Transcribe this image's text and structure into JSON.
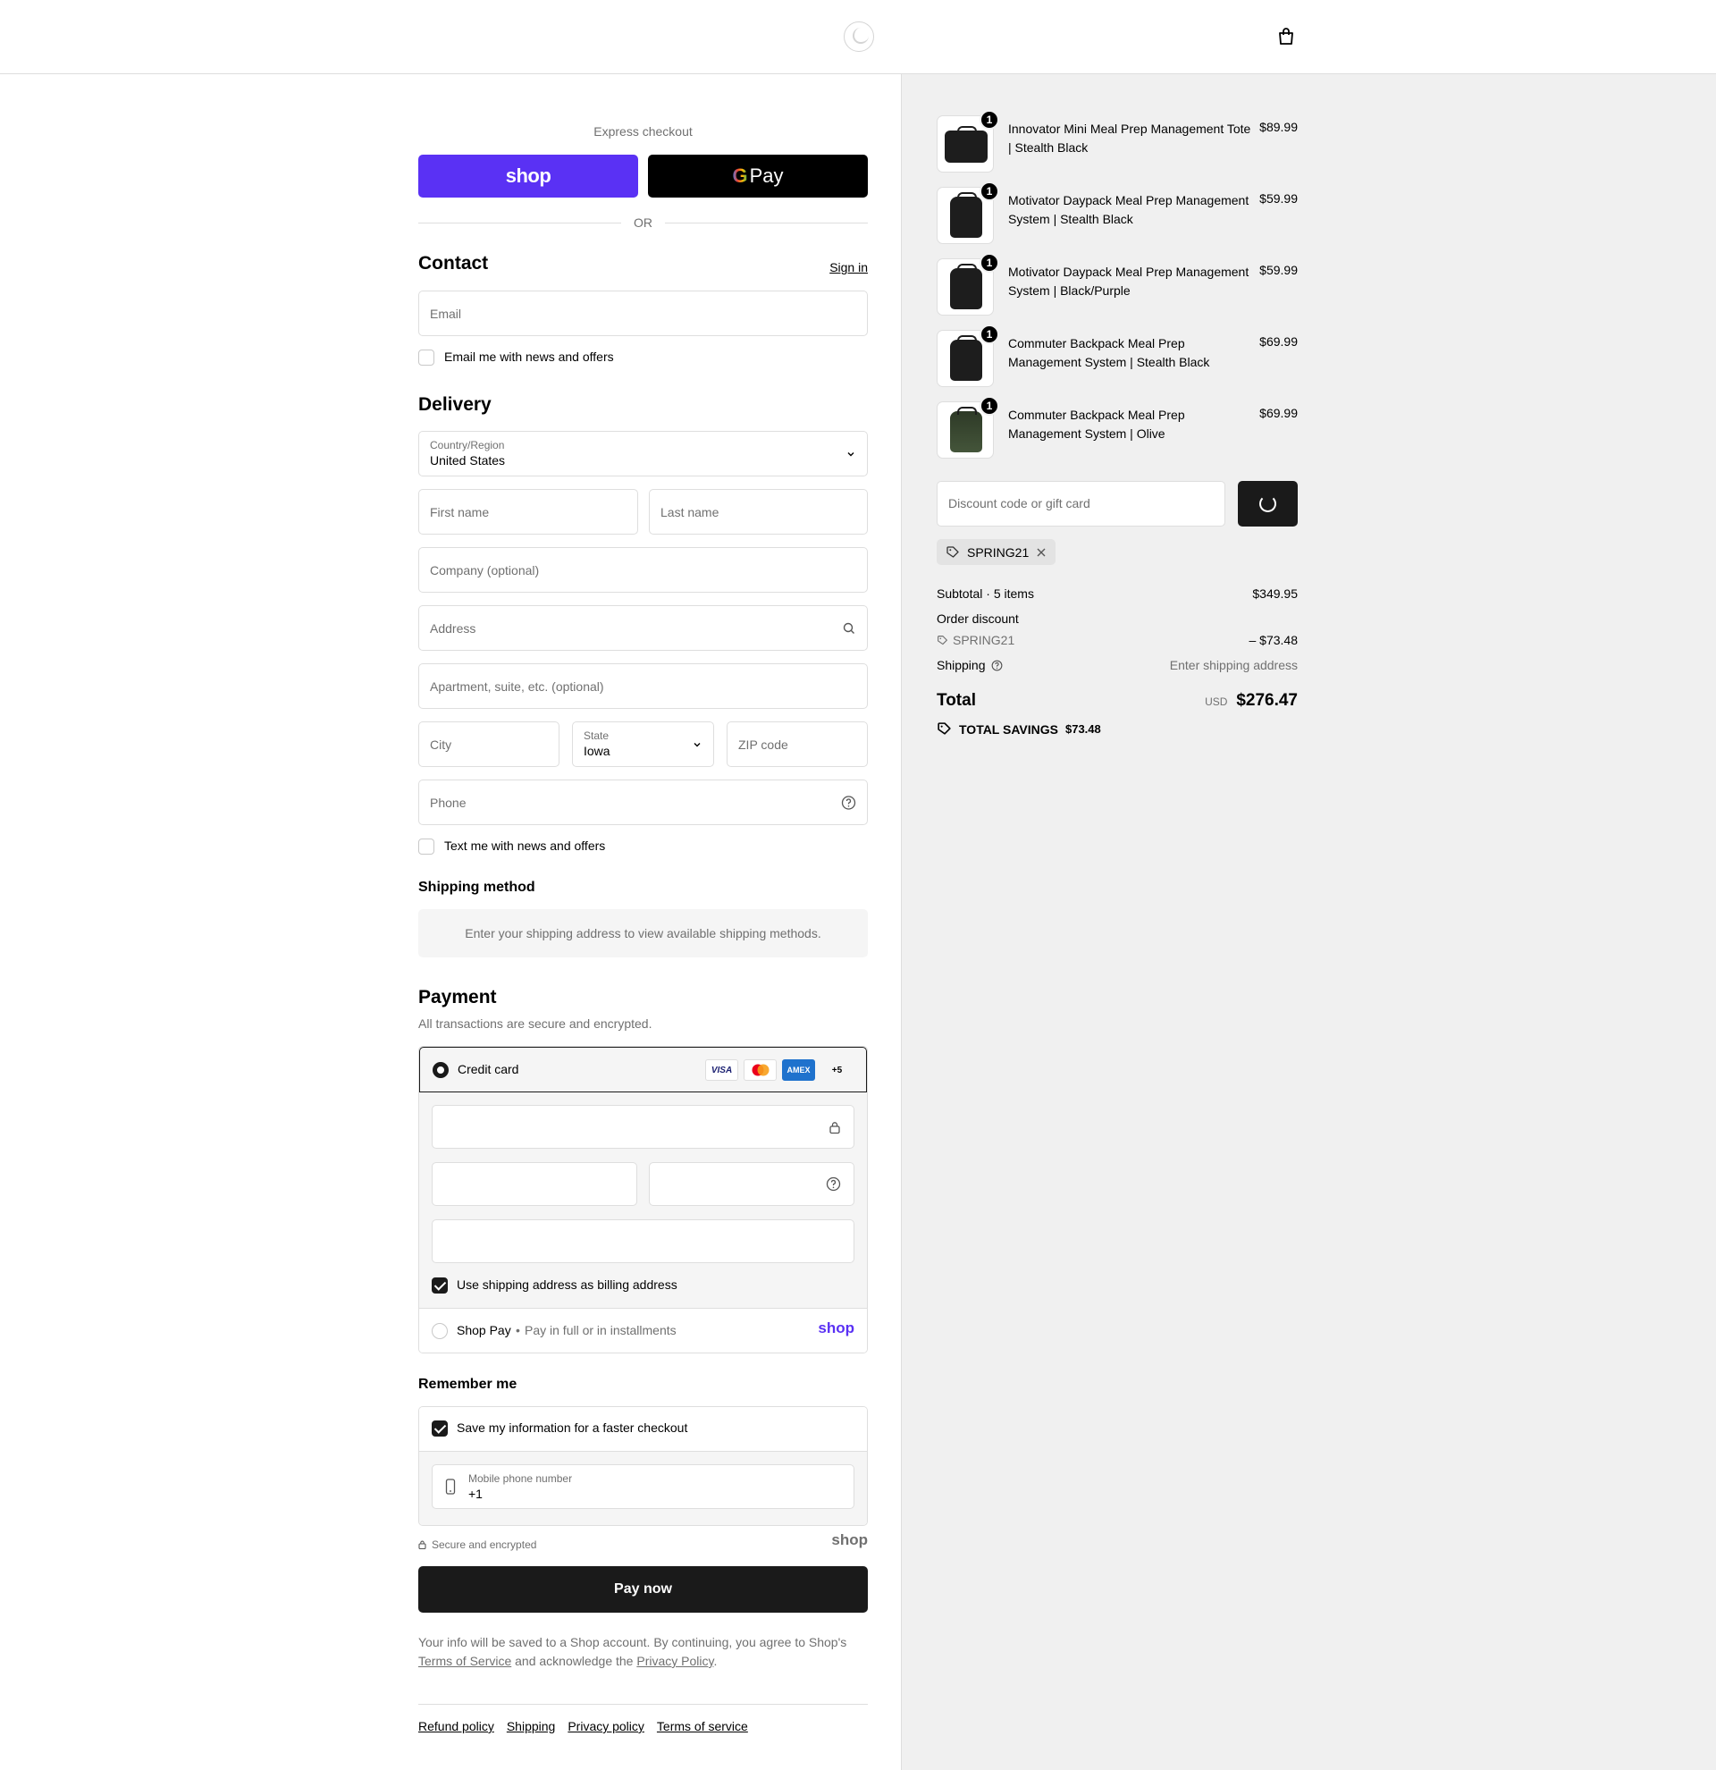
{
  "header": {
    "logo_icon": "store-logo-icon",
    "cart_icon": "shopping-bag-icon"
  },
  "express": {
    "label": "Express checkout",
    "shop_pay_label": "shop",
    "gpay_g": "G",
    "gpay_label": "Pay",
    "or_label": "OR"
  },
  "contact": {
    "title": "Contact",
    "sign_in": "Sign in",
    "email_placeholder": "Email",
    "newsletter_label": "Email me with news and offers"
  },
  "delivery": {
    "title": "Delivery",
    "country_label": "Country/Region",
    "country_value": "United States",
    "first_name_placeholder": "First name",
    "last_name_placeholder": "Last name",
    "company_placeholder": "Company (optional)",
    "address_placeholder": "Address",
    "apartment_placeholder": "Apartment, suite, etc. (optional)",
    "city_placeholder": "City",
    "state_label": "State",
    "state_value": "Iowa",
    "zip_placeholder": "ZIP code",
    "phone_placeholder": "Phone",
    "sms_label": "Text me with news and offers"
  },
  "shipping_method": {
    "title": "Shipping method",
    "notice": "Enter your shipping address to view available shipping methods."
  },
  "payment": {
    "title": "Payment",
    "subtitle": "All transactions are secure and encrypted.",
    "credit_card_label": "Credit card",
    "cards": [
      "VISA",
      "MC",
      "AMEX",
      "+5"
    ],
    "billing_label": "Use shipping address as billing address",
    "shop_pay_label": "Shop Pay",
    "shop_pay_sub": "Pay in full or in installments",
    "shop_pay_logo": "shop"
  },
  "remember": {
    "title": "Remember me",
    "save_label": "Save my information for a faster checkout",
    "mobile_label": "Mobile phone number",
    "mobile_value": "+1",
    "secure_label": "Secure and encrypted",
    "shop_logo": "shop"
  },
  "pay_now": "Pay now",
  "legal": {
    "text1": "Your info will be saved to a Shop account. By continuing, you agree to Shop's",
    "terms": "Terms of Service",
    "text2": "and acknowledge the",
    "privacy": "Privacy Policy",
    "end": "."
  },
  "footer": [
    "Refund policy",
    "Shipping",
    "Privacy policy",
    "Terms of service"
  ],
  "cart": {
    "items": [
      {
        "qty": "1",
        "name": "Innovator Mini Meal Prep Management Tote | Stealth Black",
        "price": "$89.99"
      },
      {
        "qty": "1",
        "name": "Motivator Daypack Meal Prep Management System | Stealth Black",
        "price": "$59.99"
      },
      {
        "qty": "1",
        "name": "Motivator Daypack Meal Prep Management System | Black/Purple",
        "price": "$59.99"
      },
      {
        "qty": "1",
        "name": "Commuter Backpack Meal Prep Management System | Stealth Black",
        "price": "$69.99"
      },
      {
        "qty": "1",
        "name": "Commuter Backpack Meal Prep Management System | Olive",
        "price": "$69.99"
      }
    ],
    "discount_placeholder": "Discount code or gift card",
    "applied_code": "SPRING21",
    "subtotal_label": "Subtotal · 5 items",
    "subtotal_value": "$349.95",
    "order_discount_label": "Order discount",
    "discount_code": "SPRING21",
    "discount_value": "– $73.48",
    "shipping_label": "Shipping",
    "shipping_value": "Enter shipping address",
    "total_label": "Total",
    "currency": "USD",
    "total_value": "$276.47",
    "savings_label": "TOTAL SAVINGS",
    "savings_value": "$73.48"
  }
}
